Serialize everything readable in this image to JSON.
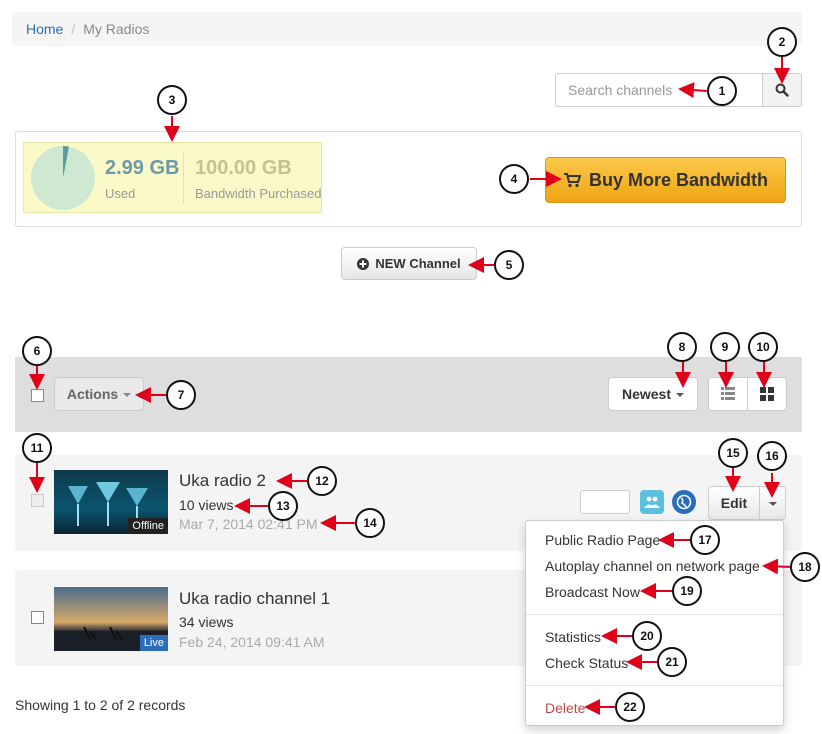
{
  "breadcrumb": {
    "home": "Home",
    "separator": "/",
    "current": "My Radios"
  },
  "search": {
    "placeholder": "Search channels",
    "icon": "search-icon"
  },
  "bandwidth": {
    "used_value": "2.99 GB",
    "used_label": "Used",
    "purchased_value": "100.00 GB",
    "purchased_label": "Bandwidth Purchased",
    "used_fraction": 0.0299,
    "buy_button_label": "Buy More Bandwidth",
    "buy_icon": "cart-icon"
  },
  "new_channel": {
    "label": "NEW Channel",
    "icon": "plus-circle-icon"
  },
  "toolbar": {
    "actions_label": "Actions",
    "sort_label": "Newest",
    "list_view_icon": "list-icon",
    "grid_view_icon": "grid-icon"
  },
  "channels": [
    {
      "title": "Uka radio 2",
      "views": "10 views",
      "date": "Mar 7, 2014 02:41 PM",
      "status": "Offline"
    },
    {
      "title": "Uka radio channel 1",
      "views": "34 views",
      "date": "Feb 24, 2014 09:41 AM",
      "status": "Live"
    }
  ],
  "row_actions": {
    "edit_label": "Edit",
    "group_icon": "users-icon",
    "globe_icon": "globe-icon"
  },
  "dropdown": {
    "items": [
      "Public Radio Page",
      "Autoplay channel on network page",
      "Broadcast Now",
      "Statistics",
      "Check Status",
      "Delete"
    ]
  },
  "footer": {
    "records": "Showing 1 to 2 of 2 records"
  },
  "callouts": [
    "1",
    "2",
    "3",
    "4",
    "5",
    "6",
    "7",
    "8",
    "9",
    "10",
    "11",
    "12",
    "13",
    "14",
    "15",
    "16",
    "17",
    "18",
    "19",
    "20",
    "21",
    "22"
  ],
  "colors": {
    "accent_blue": "#2a6ebb",
    "buy_orange": "#f5b62f",
    "callout_arrow": "#e0001a",
    "delete_red": "#b94a48"
  }
}
